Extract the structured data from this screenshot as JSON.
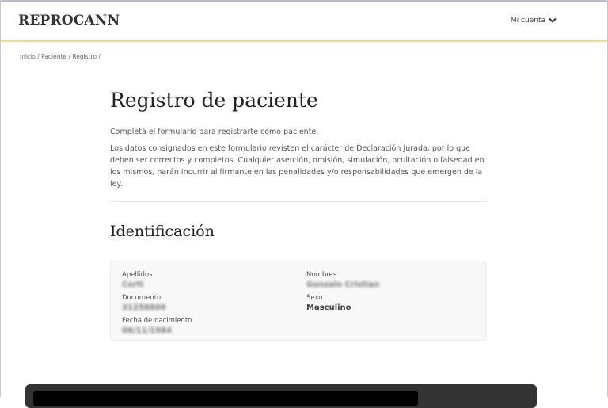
{
  "header": {
    "logo": "REPROCANN",
    "account_label": "Mi cuenta",
    "account_icon": "chevron-down-icon"
  },
  "breadcrumb": "Inicio / Paciente / Registro /",
  "main": {
    "title": "Registro de paciente",
    "intro": "Completá el formulario para registrarte como paciente.",
    "disclaimer": "Los datos consignados en este formulario revisten el carácter de Declaración Jurada, por lo que deben ser correctos y completos. Cualquier aserción, omisión, simulación, ocultación o falsedad en los mismos, harán incurrir al firmante en las penalidades y/o responsabilidades que emergen de la ley.",
    "section_title": "Identificación",
    "fields": [
      {
        "label": "Apellidos",
        "value": "Corti"
      },
      {
        "label": "Nombres",
        "value": "Gonzalo Cristian"
      },
      {
        "label": "Documento",
        "value": "31258606"
      },
      {
        "label": "Sexo",
        "value": "Masculino"
      },
      {
        "label": "Fecha de nacimiento",
        "value": "06/11/1984"
      }
    ]
  },
  "colors": {
    "accent_line": "#ecd9a4",
    "card_bg": "#f8f8f8"
  }
}
